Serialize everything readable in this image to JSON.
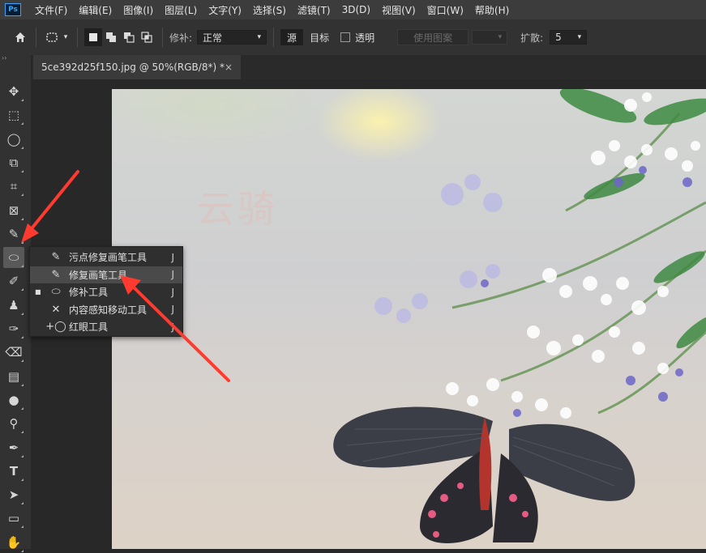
{
  "menubar": {
    "logo": "Ps",
    "items": [
      "文件(F)",
      "编辑(E)",
      "图像(I)",
      "图层(L)",
      "文字(Y)",
      "选择(S)",
      "滤镜(T)",
      "3D(D)",
      "视图(V)",
      "窗口(W)",
      "帮助(H)"
    ]
  },
  "options": {
    "patch_label": "修补:",
    "patch_mode": "正常",
    "source_label": "源",
    "target_label": "目标",
    "transparent_label": "透明",
    "use_pattern_label": "使用图案",
    "diffusion_label": "扩散:",
    "diffusion_value": "5"
  },
  "document": {
    "tab_title": "5ce392d25f150.jpg @ 50%(RGB/8*) *",
    "close_glyph": "×",
    "watermark": "云骑"
  },
  "tools": [
    {
      "name": "move-tool-icon",
      "glyph": "✥"
    },
    {
      "name": "marquee-tool-icon",
      "glyph": "⬚"
    },
    {
      "name": "lasso-tool-icon",
      "glyph": "◯"
    },
    {
      "name": "object-select-tool-icon",
      "glyph": "⧉"
    },
    {
      "name": "crop-tool-icon",
      "glyph": "⌗"
    },
    {
      "name": "frame-tool-icon",
      "glyph": "⊠"
    },
    {
      "name": "eyedropper-tool-icon",
      "glyph": "✎"
    },
    {
      "name": "patch-tool-icon",
      "glyph": "⬭"
    },
    {
      "name": "brush-tool-icon",
      "glyph": "✐"
    },
    {
      "name": "stamp-tool-icon",
      "glyph": "♟"
    },
    {
      "name": "history-brush-tool-icon",
      "glyph": "✑"
    },
    {
      "name": "eraser-tool-icon",
      "glyph": "⌫"
    },
    {
      "name": "gradient-tool-icon",
      "glyph": "▤"
    },
    {
      "name": "blur-tool-icon",
      "glyph": "●"
    },
    {
      "name": "dodge-tool-icon",
      "glyph": "⚲"
    },
    {
      "name": "pen-tool-icon",
      "glyph": "✒"
    },
    {
      "name": "type-tool-icon",
      "glyph": "T"
    },
    {
      "name": "path-select-tool-icon",
      "glyph": "➤"
    },
    {
      "name": "rectangle-tool-icon",
      "glyph": "▭"
    },
    {
      "name": "hand-tool-icon",
      "glyph": "✋"
    }
  ],
  "flyout": {
    "items": [
      {
        "label": "污点修复画笔工具",
        "key": "J",
        "current": false,
        "icon": "spot-healing-brush-icon",
        "glyph": "✎"
      },
      {
        "label": "修复画笔工具",
        "key": "J",
        "current": false,
        "icon": "healing-brush-icon",
        "glyph": "✎"
      },
      {
        "label": "修补工具",
        "key": "J",
        "current": true,
        "icon": "patch-icon",
        "glyph": "⬭",
        "mark": "■"
      },
      {
        "label": "内容感知移动工具",
        "key": "J",
        "current": false,
        "icon": "content-aware-move-icon",
        "glyph": "✕"
      },
      {
        "label": "红眼工具",
        "key": "J",
        "current": false,
        "icon": "red-eye-icon",
        "glyph": "+◯"
      }
    ]
  },
  "colors": {
    "accent": "#31a8ff",
    "annotation_arrow": "#ff3b30"
  }
}
